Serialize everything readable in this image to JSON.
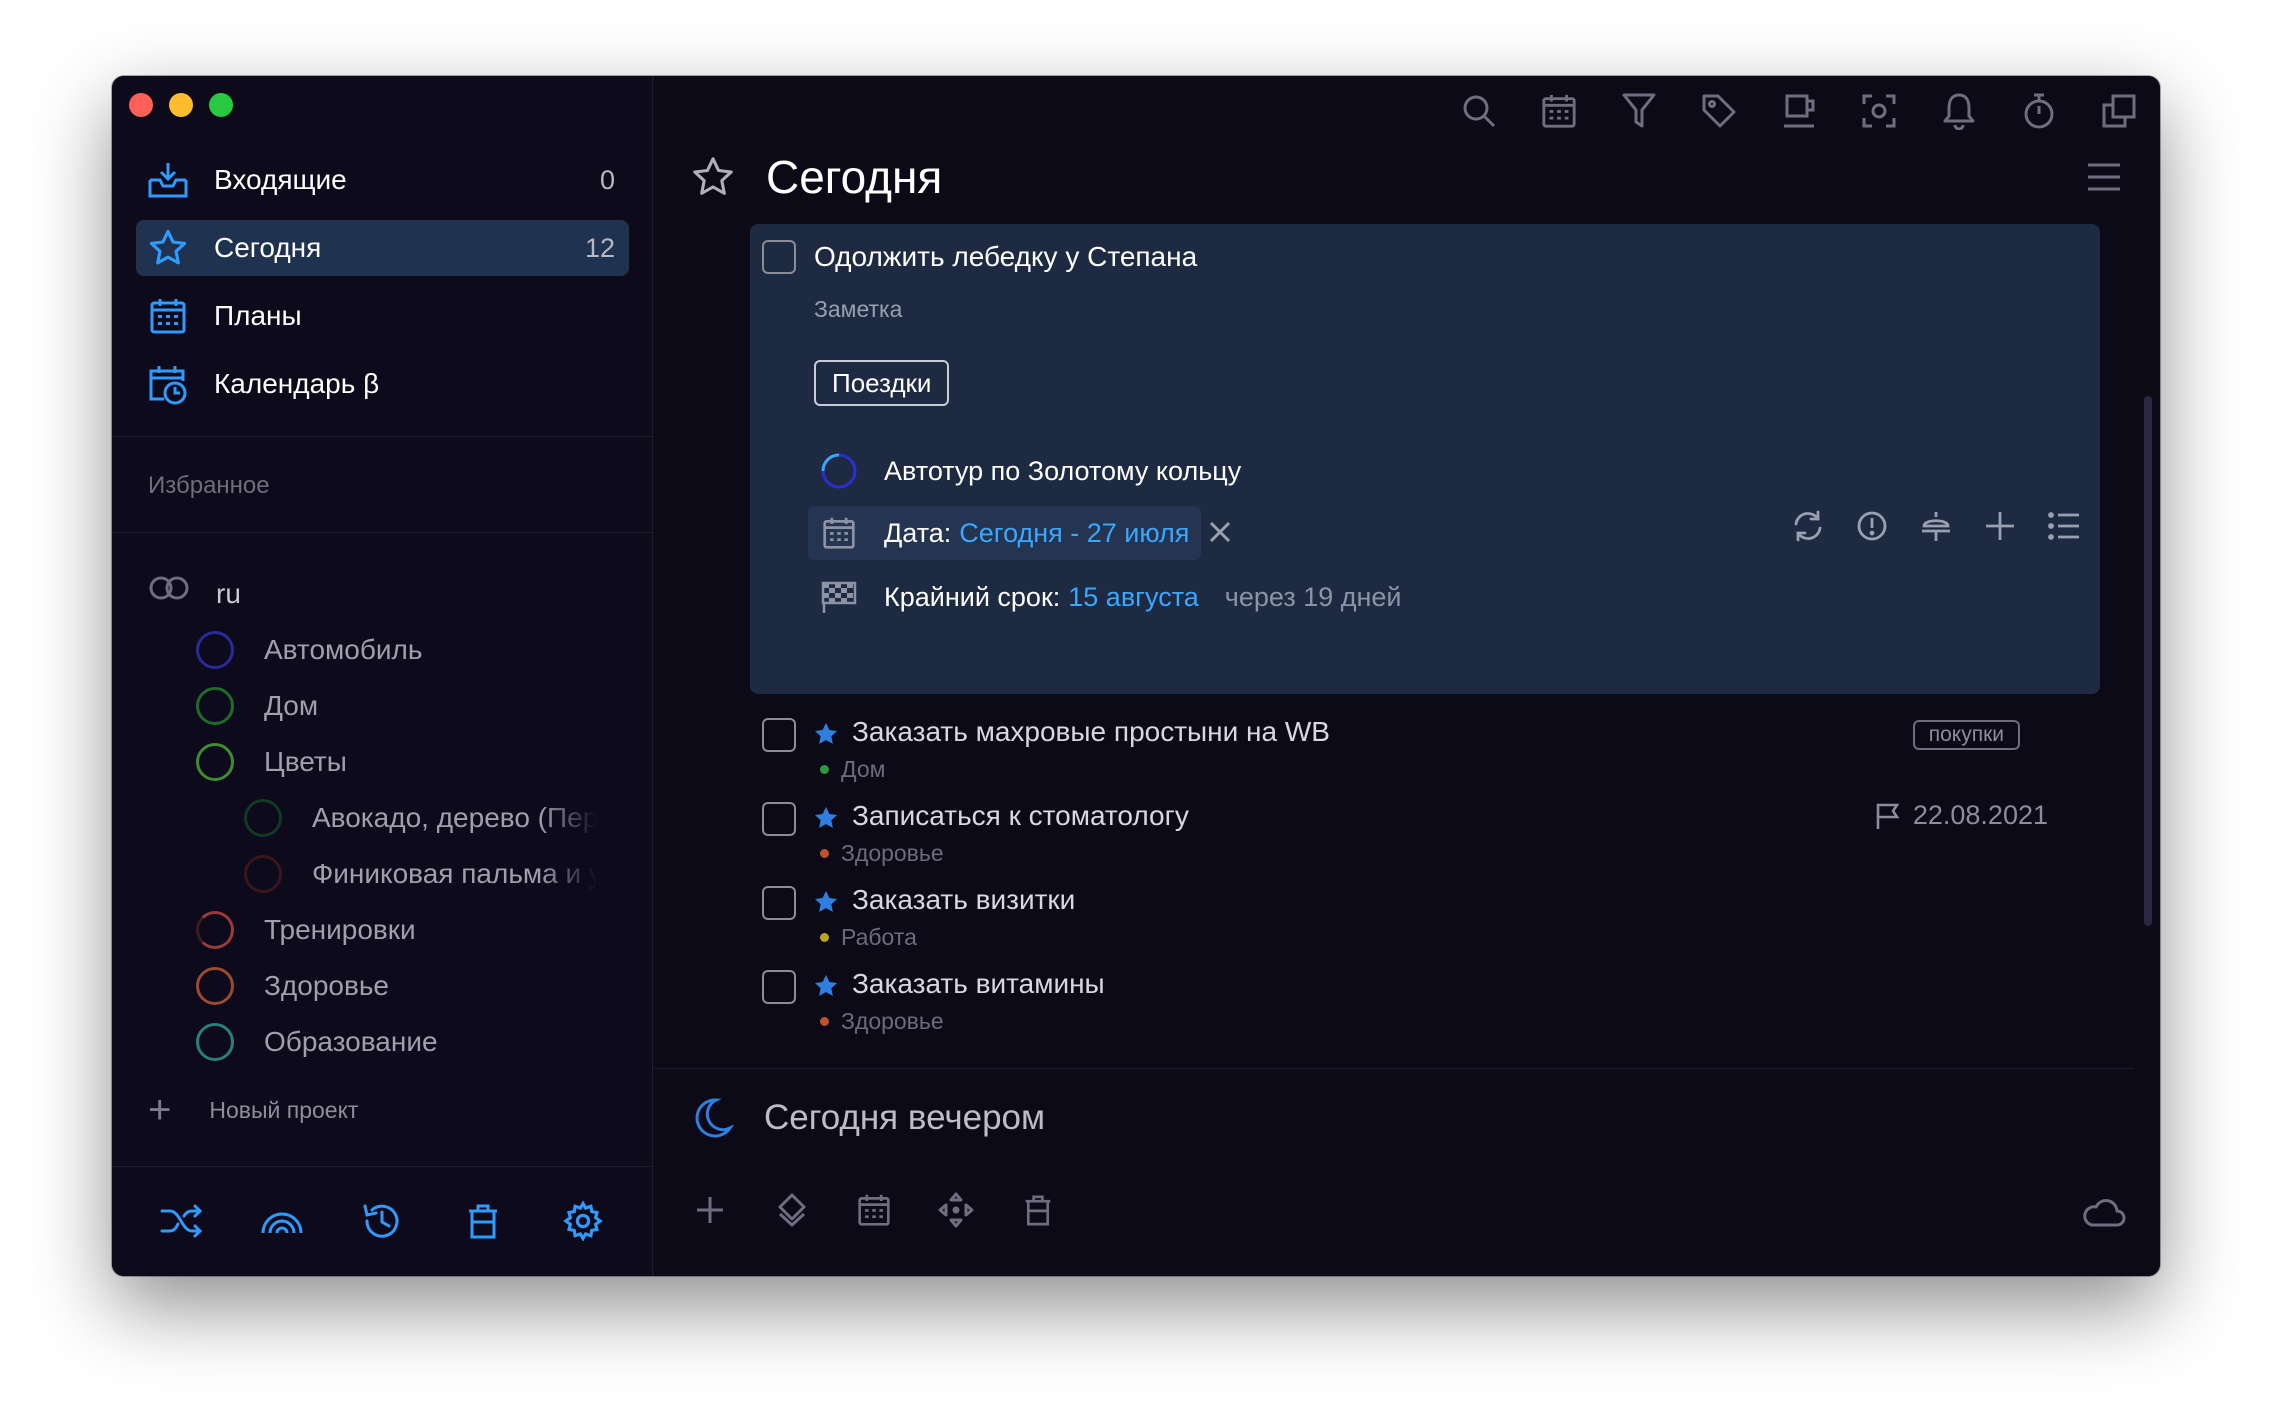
{
  "sidebar": {
    "nav": [
      {
        "label": "Входящие",
        "count": "0",
        "icon": "inbox-icon"
      },
      {
        "label": "Сегодня",
        "count": "12",
        "icon": "star-icon"
      },
      {
        "label": "Планы",
        "count": "",
        "icon": "calendar-icon"
      },
      {
        "label": "Календарь β",
        "count": "",
        "icon": "calendar-clock-icon"
      }
    ],
    "favorites_title": "Избранное",
    "group": {
      "label": "ru",
      "icon": "infinity-icon"
    },
    "projects": [
      {
        "label": "Автомобиль",
        "color": "#2b2a9c",
        "level": 1
      },
      {
        "label": "Дом",
        "color": "#1f6b2a",
        "level": 1
      },
      {
        "label": "Цветы",
        "color": "#3f8c2f",
        "level": 1
      },
      {
        "label": "Авокадо, дерево (Персея американская)",
        "color": "#123a22",
        "level": 2
      },
      {
        "label": "Финиковая пальма и уход",
        "color": "#3b1616",
        "level": 2
      },
      {
        "label": "Тренировки",
        "color": "#9a3a3a",
        "level": 1
      },
      {
        "label": "Здоровье",
        "color": "#9a4a2e",
        "level": 1
      },
      {
        "label": "Образование",
        "color": "#2a7f7a",
        "level": 1
      }
    ],
    "new_project": "Новый проект"
  },
  "main": {
    "title": "Сегодня",
    "expanded_task": {
      "title": "Одолжить лебедку у Степана",
      "note": "Заметка",
      "tag": "Поездки",
      "project": "Автотур по Золотому кольцу",
      "date_label": "Дата:",
      "date_value": "Сегодня - 27 июля",
      "deadline_label": "Крайний срок:",
      "deadline_value": "15 августа",
      "deadline_relative": "через 19 дней"
    },
    "tasks": [
      {
        "title": "Заказать махровые простыни на WB",
        "project": "Дом",
        "dot": "#2f9a3c",
        "badge": "покупки",
        "due": ""
      },
      {
        "title": "Записаться к стоматологу",
        "project": "Здоровье",
        "dot": "#c0512e",
        "badge": "",
        "due": "22.08.2021"
      },
      {
        "title": "Заказать визитки",
        "project": "Работа",
        "dot": "#b7a51e",
        "badge": "",
        "due": ""
      },
      {
        "title": "Заказать витамины",
        "project": "Здоровье",
        "dot": "#c0512e",
        "badge": "",
        "due": ""
      }
    ],
    "evening_title": "Сегодня вечером"
  },
  "colors": {
    "accent": "#38a8ff",
    "active_bg": "#1f324f",
    "card_bg": "#1d2a41"
  }
}
